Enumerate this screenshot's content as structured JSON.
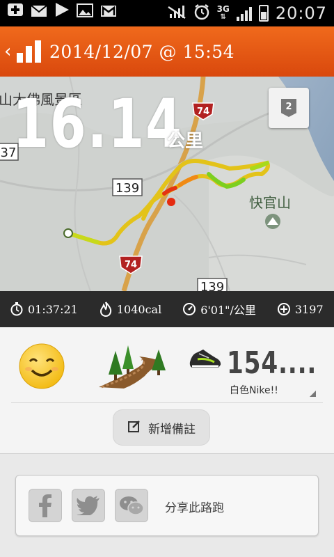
{
  "status_bar": {
    "left_icons": [
      "add-icon",
      "mail-icon",
      "play-icon",
      "image-icon",
      "gmail-icon"
    ],
    "right_icons": [
      "no-signal-icon",
      "alarm-icon",
      "3g-icon",
      "signal-icon",
      "battery-icon"
    ],
    "network": "3G",
    "time": "20:07"
  },
  "app_bar": {
    "back_glyph": "‹",
    "title": "2014/12/07 @ 15:54"
  },
  "map": {
    "distance": "16.14",
    "unit": "公里",
    "badge_number": "2",
    "labels": {
      "region": "山大佛風景區",
      "route74_top": "74",
      "route74_bottom": "74",
      "route37": "37",
      "route139_mid": "139",
      "route139_bottom": "139",
      "peak": "快官山"
    }
  },
  "stats": {
    "duration": "01:37:21",
    "calories": "1040cal",
    "pace": "6'01\"/公里",
    "fuel": "3197"
  },
  "details": {
    "shoe_distance": "154....",
    "shoe_name": "白色Nike!!",
    "add_note": "新增備註"
  },
  "share": {
    "label": "分享此路跑"
  },
  "colors": {
    "accent": "#e8571a",
    "stats_bar": "#2b2b2b"
  }
}
